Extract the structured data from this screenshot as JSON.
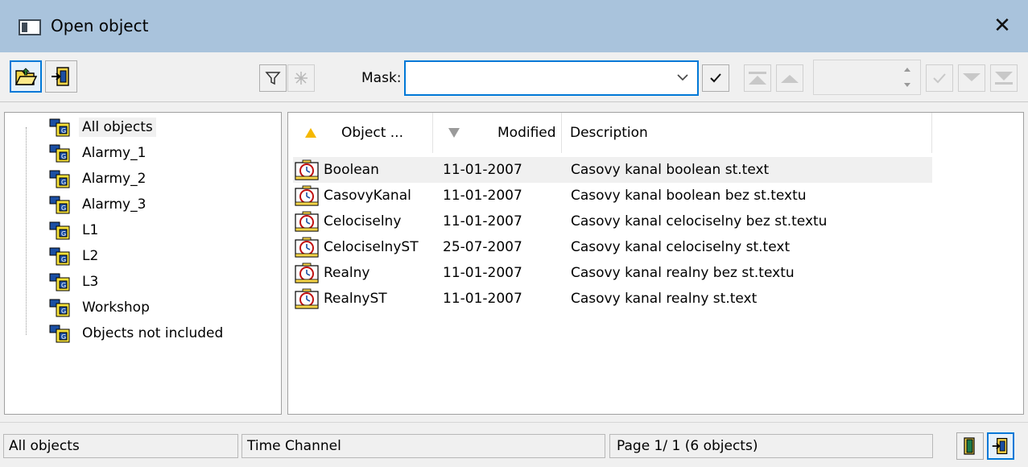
{
  "window": {
    "title": "Open object",
    "close_glyph": "✕"
  },
  "toolbar": {
    "open_icon": "open-folder-icon",
    "exit_icon": "exit-door-icon",
    "filter_icon": "filter-icon",
    "filter_off_icon": "filter-clear-icon",
    "mask_label": "Mask:",
    "mask_value": "",
    "confirm_icon": "checkmark-icon"
  },
  "tree": {
    "items": [
      {
        "label": "All objects",
        "selected": true
      },
      {
        "label": "Alarmy_1"
      },
      {
        "label": "Alarmy_2"
      },
      {
        "label": "Alarmy_3"
      },
      {
        "label": "L1"
      },
      {
        "label": "L2"
      },
      {
        "label": "L3"
      },
      {
        "label": "Workshop"
      },
      {
        "label": "Objects not included"
      }
    ]
  },
  "table": {
    "columns": [
      "Object ...",
      "Modified",
      "Description"
    ],
    "rows": [
      {
        "name": "Boolean",
        "modified": "11-01-2007",
        "description": "Casovy kanal boolean st.text"
      },
      {
        "name": "CasovyKanal",
        "modified": "11-01-2007",
        "description": "Casovy kanal boolean bez st.textu"
      },
      {
        "name": "Celociselny",
        "modified": "11-01-2007",
        "description": "Casovy kanal  celociselny bez st.textu"
      },
      {
        "name": "CelociselnyST",
        "modified": "25-07-2007",
        "description": "Casovy kanal  celociselny st.text"
      },
      {
        "name": "Realny",
        "modified": "11-01-2007",
        "description": "Casovy kanal realny  bez st.textu"
      },
      {
        "name": "RealnyST",
        "modified": "11-01-2007",
        "description": "Casovy kanal realny st.text"
      }
    ]
  },
  "status": {
    "group": "All objects",
    "type": "Time Channel",
    "page": "Page  1/ 1   (6 objects)"
  },
  "colors": {
    "titlebar": "#a9c3dc",
    "accent": "#0078d7",
    "sort_asc": "#f5b800",
    "sort_desc": "#9a9a9a"
  }
}
